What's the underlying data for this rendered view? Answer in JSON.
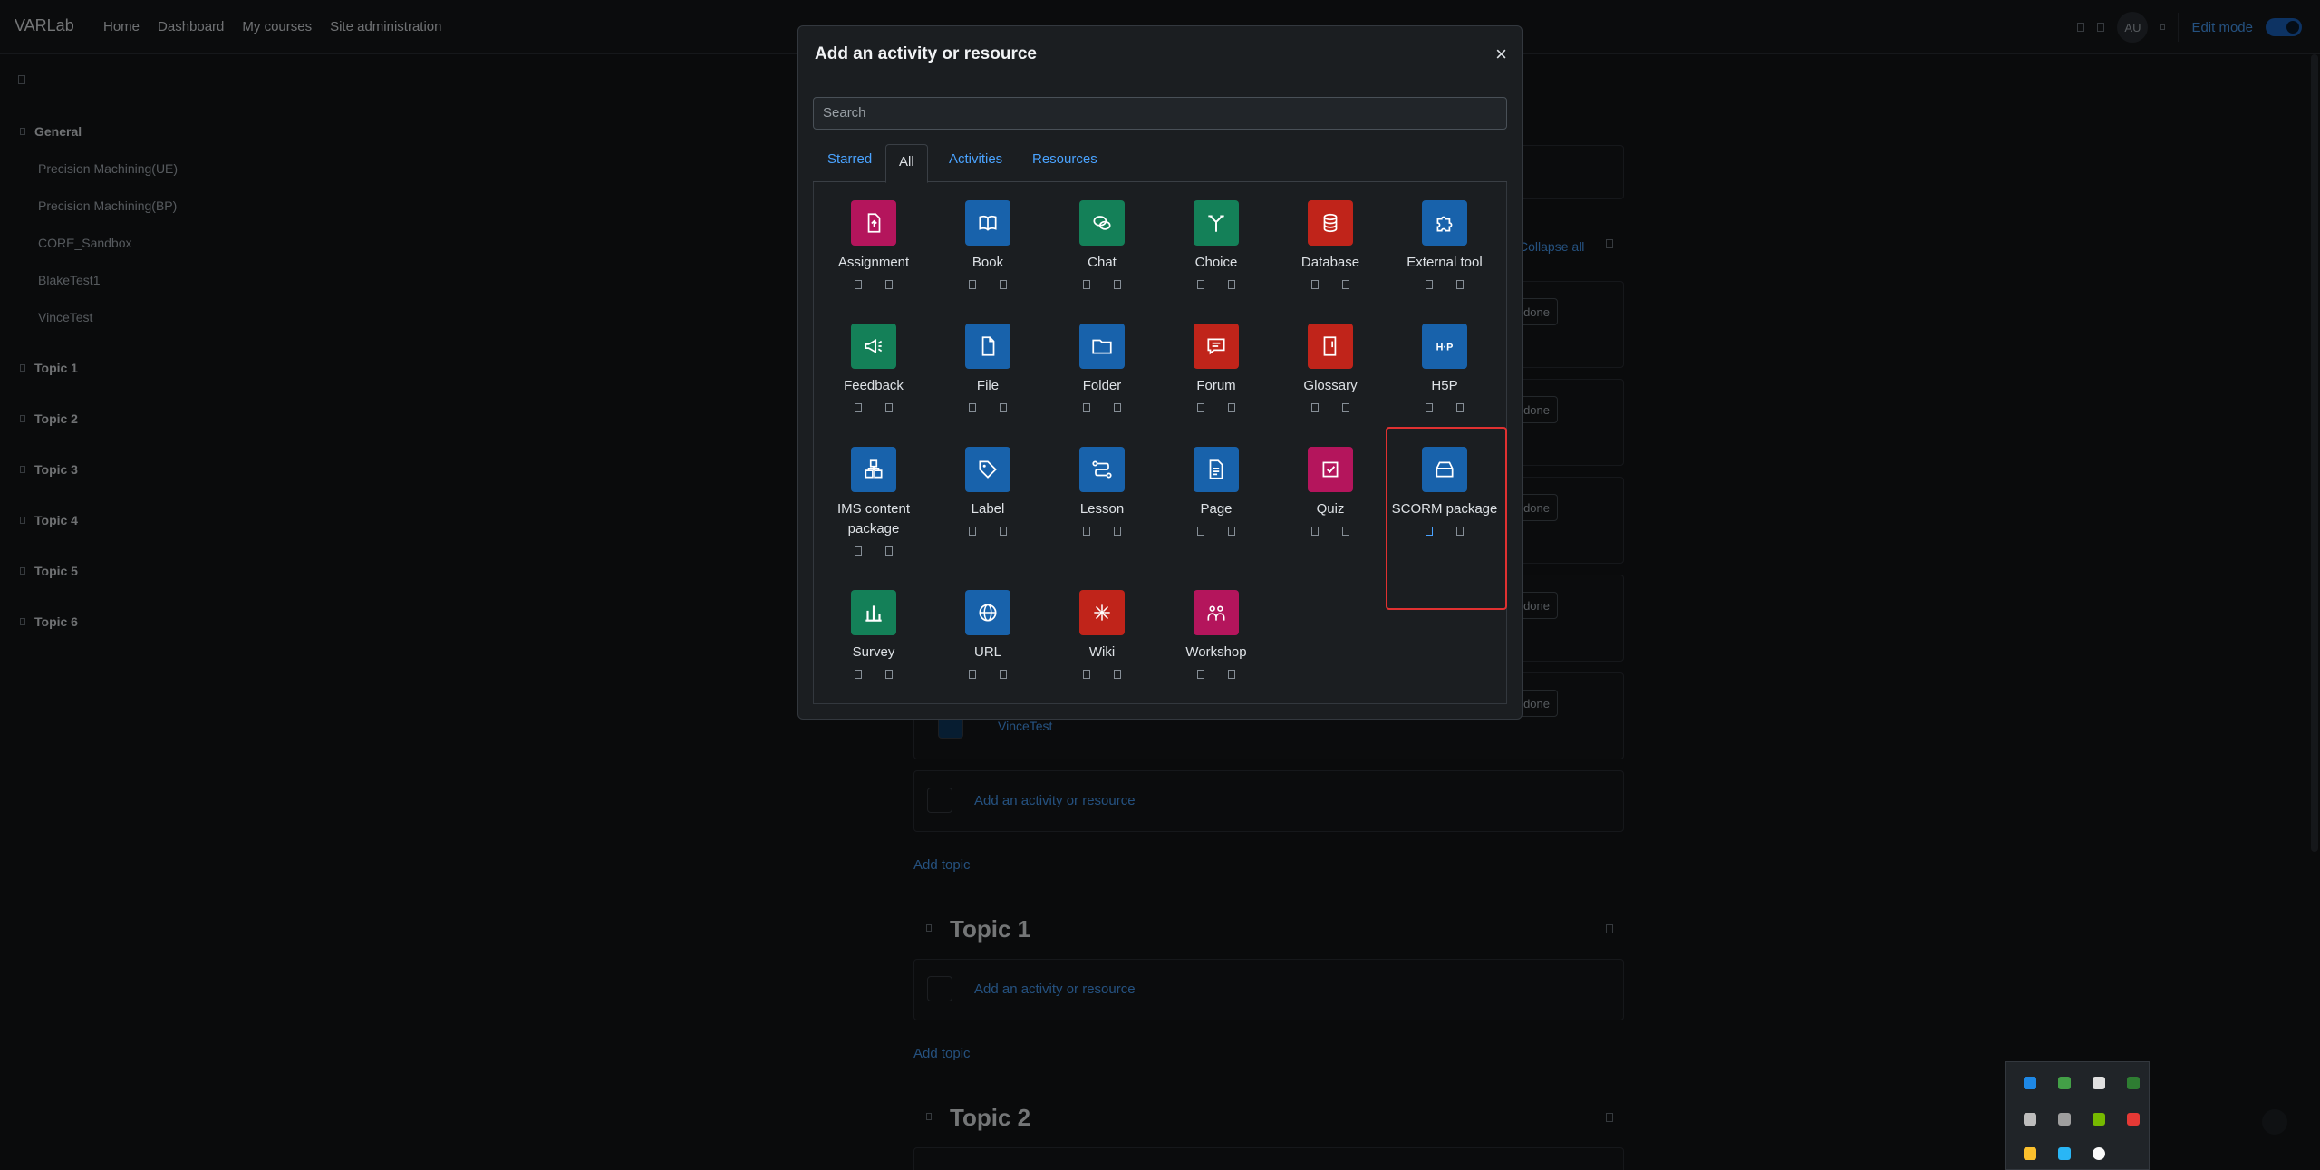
{
  "navbar": {
    "brand": "VARLab",
    "links": [
      "Home",
      "Dashboard",
      "My courses",
      "Site administration"
    ],
    "user_initials": "AU",
    "edit_mode_label": "Edit mode"
  },
  "drawer": {
    "general": "General",
    "general_items": [
      "Precision Machining(UE)",
      "Precision Machining(BP)",
      "CORE_Sandbox",
      "BlakeTest1",
      "VinceTest"
    ],
    "topics": [
      "Topic 1",
      "Topic 2",
      "Topic 3",
      "Topic 4",
      "Topic 5",
      "Topic 6"
    ]
  },
  "course": {
    "collapse_all": "Collapse all",
    "mark_done_visible": "s done",
    "vince_link": "VinceTest",
    "add_activity": "Add an activity or resource",
    "add_topic": "Add topic",
    "topic1": "Topic 1",
    "topic2": "Topic 2"
  },
  "modal": {
    "title": "Add an activity or resource",
    "close": "×",
    "search_placeholder": "Search",
    "tabs": [
      "Starred",
      "All",
      "Activities",
      "Resources"
    ],
    "active_tab": "All",
    "items": [
      {
        "name": "Assignment",
        "color": "#b4155c",
        "icon": "assignment-icon"
      },
      {
        "name": "Book",
        "color": "#1862ab",
        "icon": "book-icon"
      },
      {
        "name": "Chat",
        "color": "#148058",
        "icon": "chat-icon"
      },
      {
        "name": "Choice",
        "color": "#148058",
        "icon": "choice-icon"
      },
      {
        "name": "Database",
        "color": "#c0241a",
        "icon": "database-icon"
      },
      {
        "name": "External tool",
        "color": "#1862ab",
        "icon": "puzzle-icon"
      },
      {
        "name": "Feedback",
        "color": "#148058",
        "icon": "megaphone-icon"
      },
      {
        "name": "File",
        "color": "#1862ab",
        "icon": "file-icon"
      },
      {
        "name": "Folder",
        "color": "#1862ab",
        "icon": "folder-icon"
      },
      {
        "name": "Forum",
        "color": "#c0241a",
        "icon": "forum-icon"
      },
      {
        "name": "Glossary",
        "color": "#c0241a",
        "icon": "glossary-icon"
      },
      {
        "name": "H5P",
        "color": "#1862ab",
        "icon": "h5p-icon"
      },
      {
        "name": "IMS content package",
        "color": "#1862ab",
        "icon": "package-icon"
      },
      {
        "name": "Label",
        "color": "#1862ab",
        "icon": "tag-icon"
      },
      {
        "name": "Lesson",
        "color": "#1862ab",
        "icon": "lesson-icon"
      },
      {
        "name": "Page",
        "color": "#1862ab",
        "icon": "page-icon"
      },
      {
        "name": "Quiz",
        "color": "#b4155c",
        "icon": "quiz-icon"
      },
      {
        "name": "SCORM package",
        "color": "#1862ab",
        "icon": "scorm-icon"
      },
      {
        "name": "Survey",
        "color": "#148058",
        "icon": "chart-icon"
      },
      {
        "name": "URL",
        "color": "#1862ab",
        "icon": "globe-icon"
      },
      {
        "name": "Wiki",
        "color": "#c0241a",
        "icon": "wiki-icon"
      },
      {
        "name": "Workshop",
        "color": "#b4155c",
        "icon": "workshop-icon"
      }
    ],
    "selected_item": "SCORM package"
  }
}
